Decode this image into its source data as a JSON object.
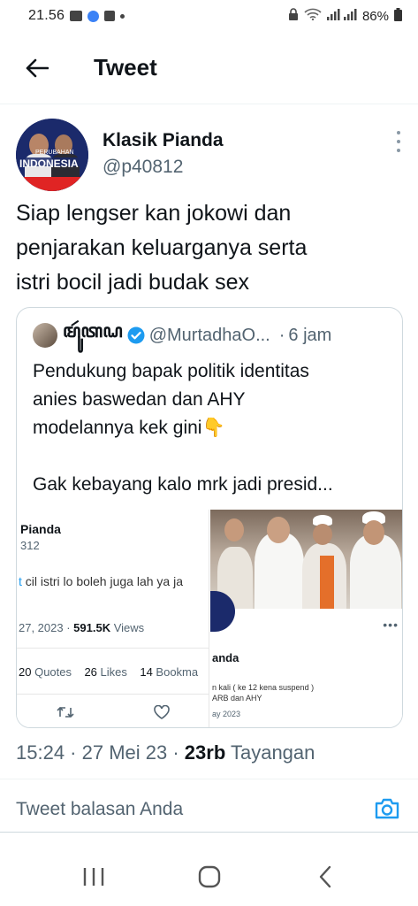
{
  "status_bar": {
    "time": "21.56",
    "battery": "86%"
  },
  "header": {
    "title": "Tweet",
    "back_icon": "arrow-left-icon"
  },
  "tweet": {
    "author_name": "Klasik Pianda",
    "author_handle": "@p40812",
    "avatar_text_top": "PERUBAHAN",
    "avatar_text_main": "INDONESIA",
    "text_lines": [
      "Siap lengser kan jokowi dan",
      "penjarakan keluarganya serta",
      "istri bocil jadi budak sex"
    ],
    "timestamp": "15:24 · 27 Mei 23 · ",
    "views_count": "23rb",
    "views_label": " Tayangan"
  },
  "quote": {
    "name": "ꦩꦸꦂꦠꦝ",
    "handle": "@MurtadhaO...",
    "time": "6 jam",
    "text_lines": [
      "Pendukung bapak politik identitas",
      "anies baswedan dan AHY",
      "modelannya kek gini👇",
      "",
      "Gak kebayang kalo mrk jadi presid..."
    ],
    "left_shot": {
      "name": "Pianda",
      "handle": "312",
      "text_blue": "t",
      "text": " cil istri lo boleh juga lah ya ja",
      "date": "27, 2023 · ",
      "views_count": "591.5K",
      "views_label": " Views",
      "stats": [
        {
          "count": "20",
          "label": " Quotes"
        },
        {
          "count": "26",
          "label": " Likes"
        },
        {
          "count": "14",
          "label": " Bookma"
        }
      ]
    },
    "right_shot": {
      "name": "anda",
      "line1": "n kali ( ke 12 kena suspend )",
      "line2": "ARB dan AHY",
      "date": "ay 2023"
    }
  },
  "reply": {
    "placeholder": "Tweet balasan Anda"
  },
  "colors": {
    "text": "#0f1419",
    "secondary": "#536471",
    "accent": "#1d9bf0",
    "border": "#cfd9de"
  }
}
